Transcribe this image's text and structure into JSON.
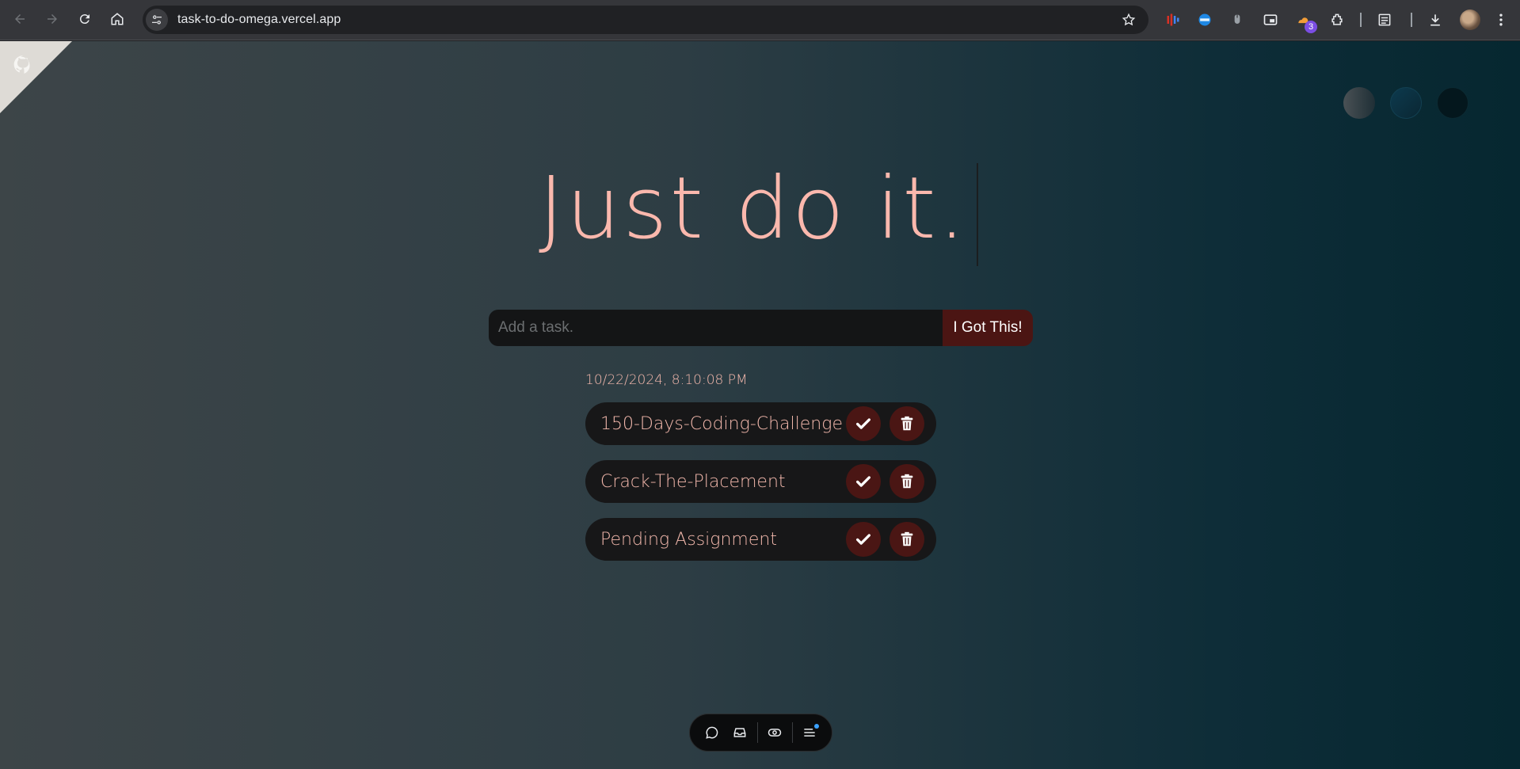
{
  "browser": {
    "url": "task-to-do-omega.vercel.app",
    "profile_badge_count": "3"
  },
  "page": {
    "headline": "Just do it.",
    "input_placeholder": "Add a task.",
    "submit_label": "I Got This!",
    "timestamp": "10/22/2024, 8:10:08 PM",
    "tasks": [
      {
        "text": "150-Days-Coding-Challenge"
      },
      {
        "text": "Crack-The-Placement"
      },
      {
        "text": "Pending Assignment"
      }
    ],
    "theme_options": [
      "standard-theme",
      "light-theme",
      "darker-theme"
    ]
  },
  "colors": {
    "accent_text": "#fbb8ad",
    "button_bg": "#4a1614",
    "input_bg": "#141516"
  }
}
